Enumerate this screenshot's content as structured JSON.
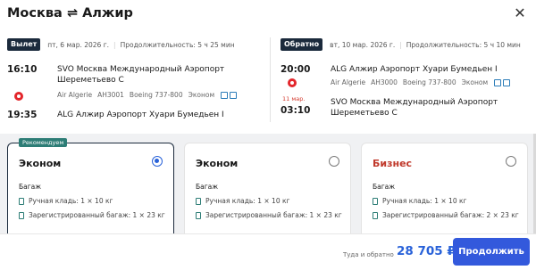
{
  "header": {
    "origin_city": "Москва",
    "swap_symbol": "⇌",
    "destination_city": "Алжир",
    "close_symbol": "✕"
  },
  "outbound": {
    "badge": "Вылет",
    "date": "пт, 6 мар. 2026 г.",
    "duration": "Продолжительность: 5 ч 25 мин",
    "dep_time": "16:10",
    "arr_time": "19:35",
    "dep_airport": "SVO Москва Международный Аэропорт Шереметьево С",
    "airline": "Air Algerie",
    "flight_no": "AH3001",
    "aircraft": "Boeing 737-800",
    "cabin": "Эконом",
    "arr_airport": "ALG Алжир Аэропорт Хуари Бумедьен I"
  },
  "return": {
    "badge": "Обратно",
    "date": "вт, 10 мар. 2026 г.",
    "duration": "Продолжительность: 5 ч 10 мин",
    "dep_time": "20:00",
    "next_day": "11 мар.",
    "arr_time": "03:10",
    "dep_airport": "ALG Алжир Аэропорт Хуари Бумедьен I",
    "airline": "Air Algerie",
    "flight_no": "AH3000",
    "aircraft": "Boeing 737-800",
    "cabin": "Эконом",
    "arr_airport": "SVO Москва Международный Аэропорт Шереметьево С"
  },
  "fares": [
    {
      "badge": "Рекомендуем",
      "title": "Эконом",
      "selected": true,
      "baggage_label": "Багаж",
      "hand": "Ручная кладь: 1 × 10 кг",
      "checked": "Зарегистрированный багаж: 1 × 23 кг"
    },
    {
      "title": "Эконом",
      "selected": false,
      "baggage_label": "Багаж",
      "hand": "Ручная кладь: 1 × 10 кг",
      "checked": "Зарегистрированный багаж: 1 × 23 кг"
    },
    {
      "title": "Бизнес",
      "selected": false,
      "baggage_label": "Багаж",
      "hand": "Ручная кладь: 1 × 10 кг",
      "checked": "Зарегистрированный багаж: 2 × 23 кг"
    }
  ],
  "footer": {
    "price_label": "Туда и обратно",
    "price": "28 705 ₽",
    "continue_label": "Продолжить"
  },
  "colors": {
    "accent": "#3359dc",
    "dark_badge": "#1b2a3c",
    "recommended": "#2d7d76",
    "business": "#c0392b",
    "airline_logo": "#e3262b"
  }
}
